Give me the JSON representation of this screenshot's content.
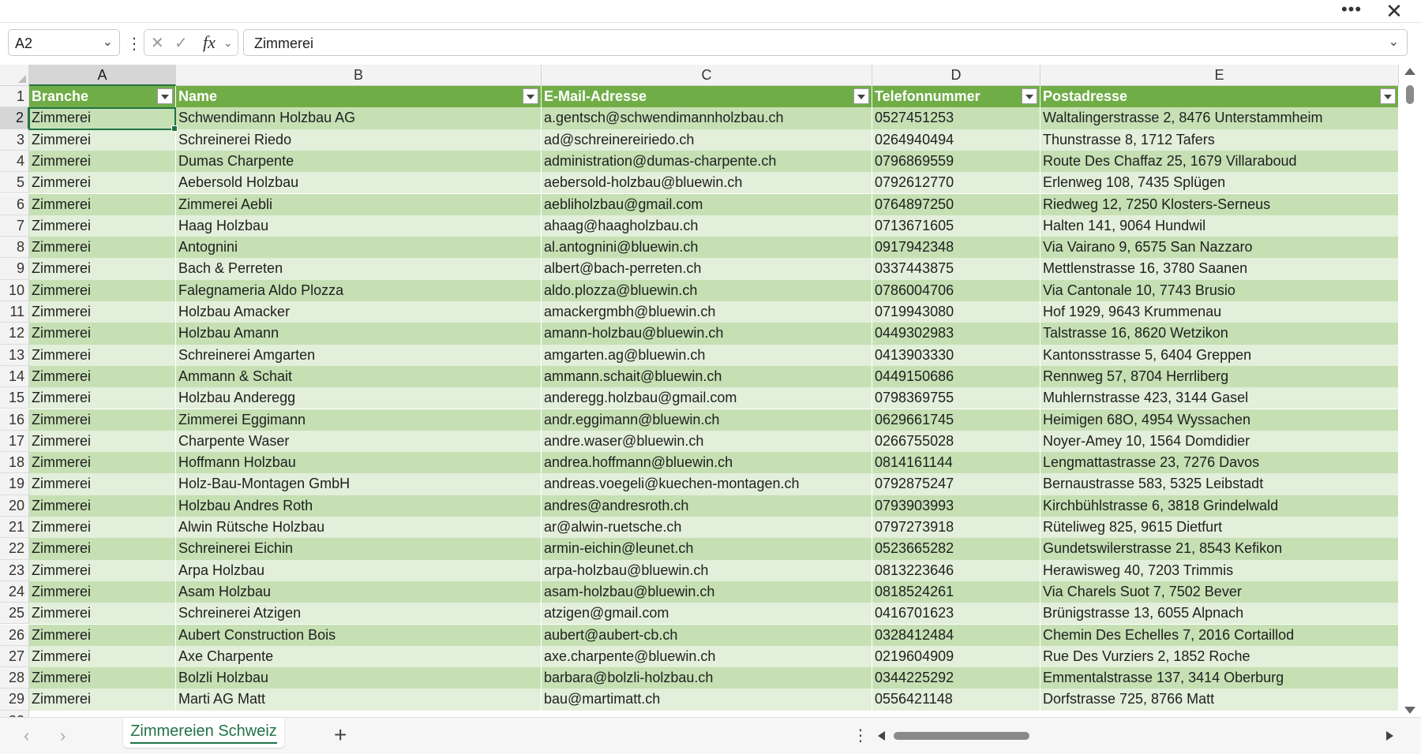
{
  "window": {
    "more_icon": "ellipsis-icon",
    "close_icon": "close-icon"
  },
  "formula_bar": {
    "name_box": "A2",
    "fx_label": "fx",
    "content": "Zimmerei"
  },
  "columns": [
    "A",
    "B",
    "C",
    "D",
    "E"
  ],
  "selected_column": "A",
  "table": {
    "headers": [
      "Branche",
      "Name",
      "E-Mail-Adresse",
      "Telefonnummer",
      "Postadresse"
    ],
    "rows": [
      [
        "Zimmerei",
        "Schwendimann Holzbau AG",
        "a.gentsch@schwendimannholzbau.ch",
        "0527451253",
        "Waltalingerstrasse 2, 8476 Unterstammheim"
      ],
      [
        "Zimmerei",
        "Schreinerei Riedo",
        "ad@schreinereiriedo.ch",
        "0264940494",
        "Thunstrasse 8, 1712 Tafers"
      ],
      [
        "Zimmerei",
        "Dumas Charpente",
        "administration@dumas-charpente.ch",
        "0796869559",
        "Route Des Chaffaz 25, 1679 Villaraboud"
      ],
      [
        "Zimmerei",
        "Aebersold Holzbau",
        "aebersold-holzbau@bluewin.ch",
        "0792612770",
        "Erlenweg 108, 7435 Splügen"
      ],
      [
        "Zimmerei",
        "Zimmerei Aebli",
        "aebliholzbau@gmail.com",
        "0764897250",
        "Riedweg 12, 7250 Klosters-Serneus"
      ],
      [
        "Zimmerei",
        "Haag Holzbau",
        "ahaag@haagholzbau.ch",
        "0713671605",
        "Halten 141, 9064 Hundwil"
      ],
      [
        "Zimmerei",
        "Antognini",
        "al.antognini@bluewin.ch",
        "0917942348",
        "Via Vairano 9, 6575 San Nazzaro"
      ],
      [
        "Zimmerei",
        "Bach & Perreten",
        "albert@bach-perreten.ch",
        "0337443875",
        "Mettlenstrasse 16, 3780 Saanen"
      ],
      [
        "Zimmerei",
        "Falegnameria Aldo Plozza",
        "aldo.plozza@bluewin.ch",
        "0786004706",
        "Via Cantonale 10, 7743 Brusio"
      ],
      [
        "Zimmerei",
        "Holzbau Amacker",
        "amackergmbh@bluewin.ch",
        "0719943080",
        "Hof 1929, 9643 Krummenau"
      ],
      [
        "Zimmerei",
        "Holzbau Amann",
        "amann-holzbau@bluewin.ch",
        "0449302983",
        "Talstrasse 16, 8620 Wetzikon"
      ],
      [
        "Zimmerei",
        "Schreinerei Amgarten",
        "amgarten.ag@bluewin.ch",
        "0413903330",
        "Kantonsstrasse 5, 6404 Greppen"
      ],
      [
        "Zimmerei",
        "Ammann & Schait",
        "ammann.schait@bluewin.ch",
        "0449150686",
        "Rennweg 57, 8704 Herrliberg"
      ],
      [
        "Zimmerei",
        "Holzbau Anderegg",
        "anderegg.holzbau@gmail.com",
        "0798369755",
        "Muhlernstrasse 423, 3144 Gasel"
      ],
      [
        "Zimmerei",
        "Zimmerei Eggimann",
        "andr.eggimann@bluewin.ch",
        "0629661745",
        "Heimigen 68O, 4954 Wyssachen"
      ],
      [
        "Zimmerei",
        "Charpente Waser",
        "andre.waser@bluewin.ch",
        "0266755028",
        "Noyer-Amey 10, 1564 Domdidier"
      ],
      [
        "Zimmerei",
        "Hoffmann Holzbau",
        "andrea.hoffmann@bluewin.ch",
        "0814161144",
        "Lengmattastrasse 23, 7276 Davos"
      ],
      [
        "Zimmerei",
        "Holz-Bau-Montagen GmbH",
        "andreas.voegeli@kuechen-montagen.ch",
        "0792875247",
        "Bernaustrasse 583, 5325 Leibstadt"
      ],
      [
        "Zimmerei",
        "Holzbau Andres Roth",
        "andres@andresroth.ch",
        "0793903993",
        "Kirchbühlstrasse 6, 3818 Grindelwald"
      ],
      [
        "Zimmerei",
        "Alwin Rütsche Holzbau",
        "ar@alwin-ruetsche.ch",
        "0797273918",
        "Rüteliweg 825, 9615 Dietfurt"
      ],
      [
        "Zimmerei",
        "Schreinerei Eichin",
        "armin-eichin@leunet.ch",
        "0523665282",
        "Gundetswilerstrasse 21, 8543 Kefikon"
      ],
      [
        "Zimmerei",
        "Arpa Holzbau",
        "arpa-holzbau@bluewin.ch",
        "0813223646",
        "Herawisweg 40, 7203 Trimmis"
      ],
      [
        "Zimmerei",
        "Asam Holzbau",
        "asam-holzbau@bluewin.ch",
        "0818524261",
        "Via Charels Suot 7, 7502 Bever"
      ],
      [
        "Zimmerei",
        "Schreinerei Atzigen",
        "atzigen@gmail.com",
        "0416701623",
        "Brünigstrasse 13, 6055 Alpnach"
      ],
      [
        "Zimmerei",
        "Aubert Construction Bois",
        "aubert@aubert-cb.ch",
        "0328412484",
        "Chemin Des Echelles 7, 2016 Cortaillod"
      ],
      [
        "Zimmerei",
        "Axe Charpente",
        "axe.charpente@bluewin.ch",
        "0219604909",
        "Rue Des Vurziers 2, 1852 Roche"
      ],
      [
        "Zimmerei",
        "Bolzli Holzbau",
        "barbara@bolzli-holzbau.ch",
        "0344225292",
        "Emmentalstrasse 137, 3414 Oberburg"
      ],
      [
        "Zimmerei",
        "Marti AG Matt",
        "bau@martimatt.ch",
        "0556421148",
        "Dorfstrasse 725, 8766 Matt"
      ]
    ]
  },
  "sheet_tabs": {
    "active": "Zimmereien Schweiz",
    "add_label": "+"
  }
}
